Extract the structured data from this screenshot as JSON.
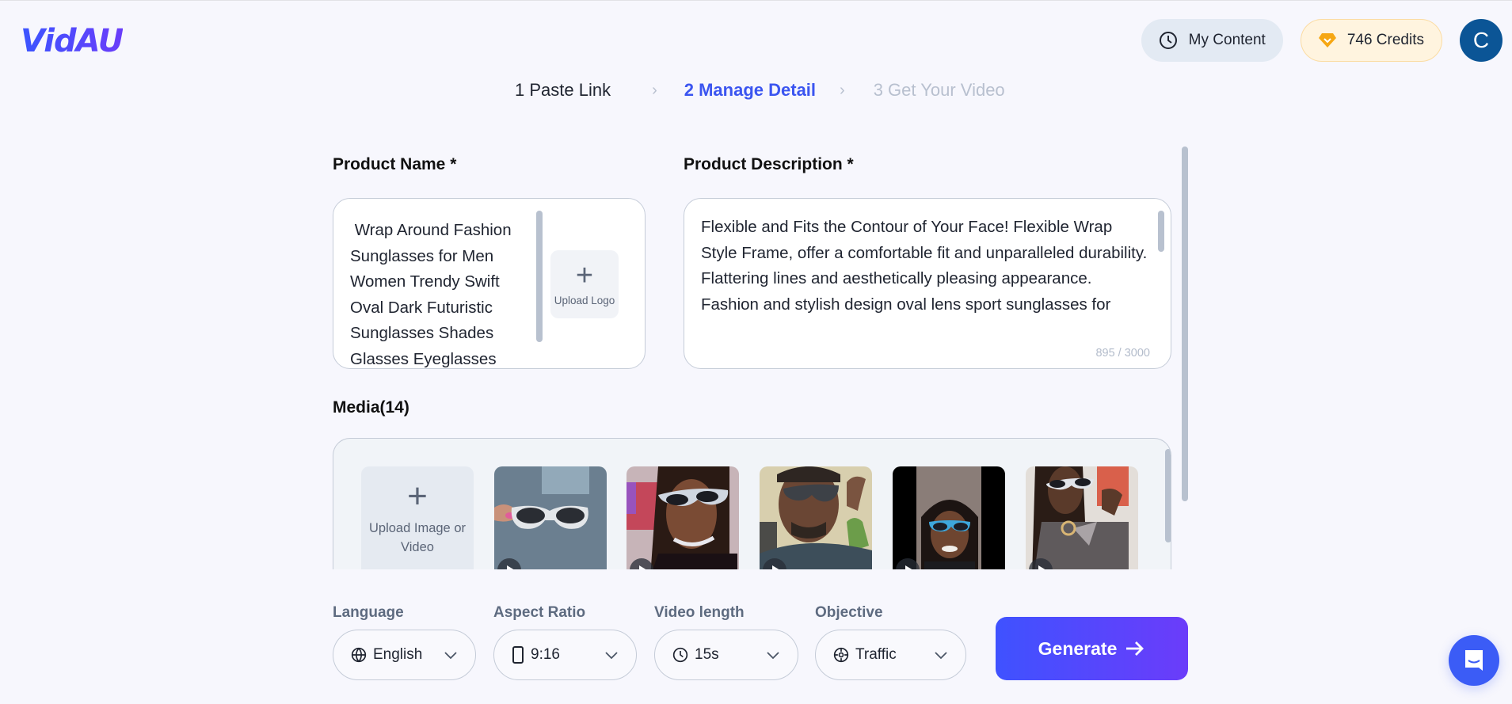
{
  "header": {
    "logo": "VidAU",
    "my_content_label": "My Content",
    "credits_label": "746 Credits",
    "avatar_initial": "C"
  },
  "stepper": {
    "steps": [
      {
        "label": "1 Paste Link",
        "state": "done"
      },
      {
        "label": "2 Manage Detail",
        "state": "active"
      },
      {
        "label": "3 Get Your Video",
        "state": "todo"
      }
    ]
  },
  "product_name": {
    "label": "Product Name *",
    "value": " Wrap Around Fashion Sunglasses for Men Women Trendy Swift Oval Dark Futuristic Sunglasses Shades Glasses Eyeglasses",
    "upload_logo_label": "Upload Logo"
  },
  "product_description": {
    "label": "Product Description *",
    "value": "Flexible and Fits the Contour of Your Face! Flexible Wrap Style Frame, offer a comfortable fit and unparalleled durability.\nFlattering lines and aesthetically pleasing appearance. Fashion and stylish design oval lens sport sunglasses for",
    "char_count": "895 / 3000"
  },
  "media": {
    "label": "Media(14)",
    "upload_label": "Upload Image or Video",
    "items": [
      {
        "type": "video",
        "subject": "hand holding silver wrap sunglasses"
      },
      {
        "type": "video",
        "subject": "woman wearing silver sunglasses with necklace"
      },
      {
        "type": "video",
        "subject": "man wearing dark wrap sunglasses"
      },
      {
        "type": "video",
        "subject": "woman wearing blue sunglasses"
      },
      {
        "type": "video",
        "subject": "woman mirror selfie with silver sunglasses"
      }
    ]
  },
  "controls": {
    "language": {
      "label": "Language",
      "value": "English",
      "icon": "globe-icon"
    },
    "aspect_ratio": {
      "label": "Aspect Ratio",
      "value": "9:16",
      "icon": "phone-icon"
    },
    "video_length": {
      "label": "Video length",
      "value": "15s",
      "icon": "clock-icon"
    },
    "objective": {
      "label": "Objective",
      "value": "Traffic",
      "icon": "target-icon"
    },
    "generate_label": "Generate"
  },
  "colors": {
    "accent": "#3b55f0",
    "brand_gradient_start": "#3f52ff",
    "brand_gradient_end": "#6b3cfa",
    "avatar": "#0b5596",
    "credits_bg": "#fff4df"
  }
}
